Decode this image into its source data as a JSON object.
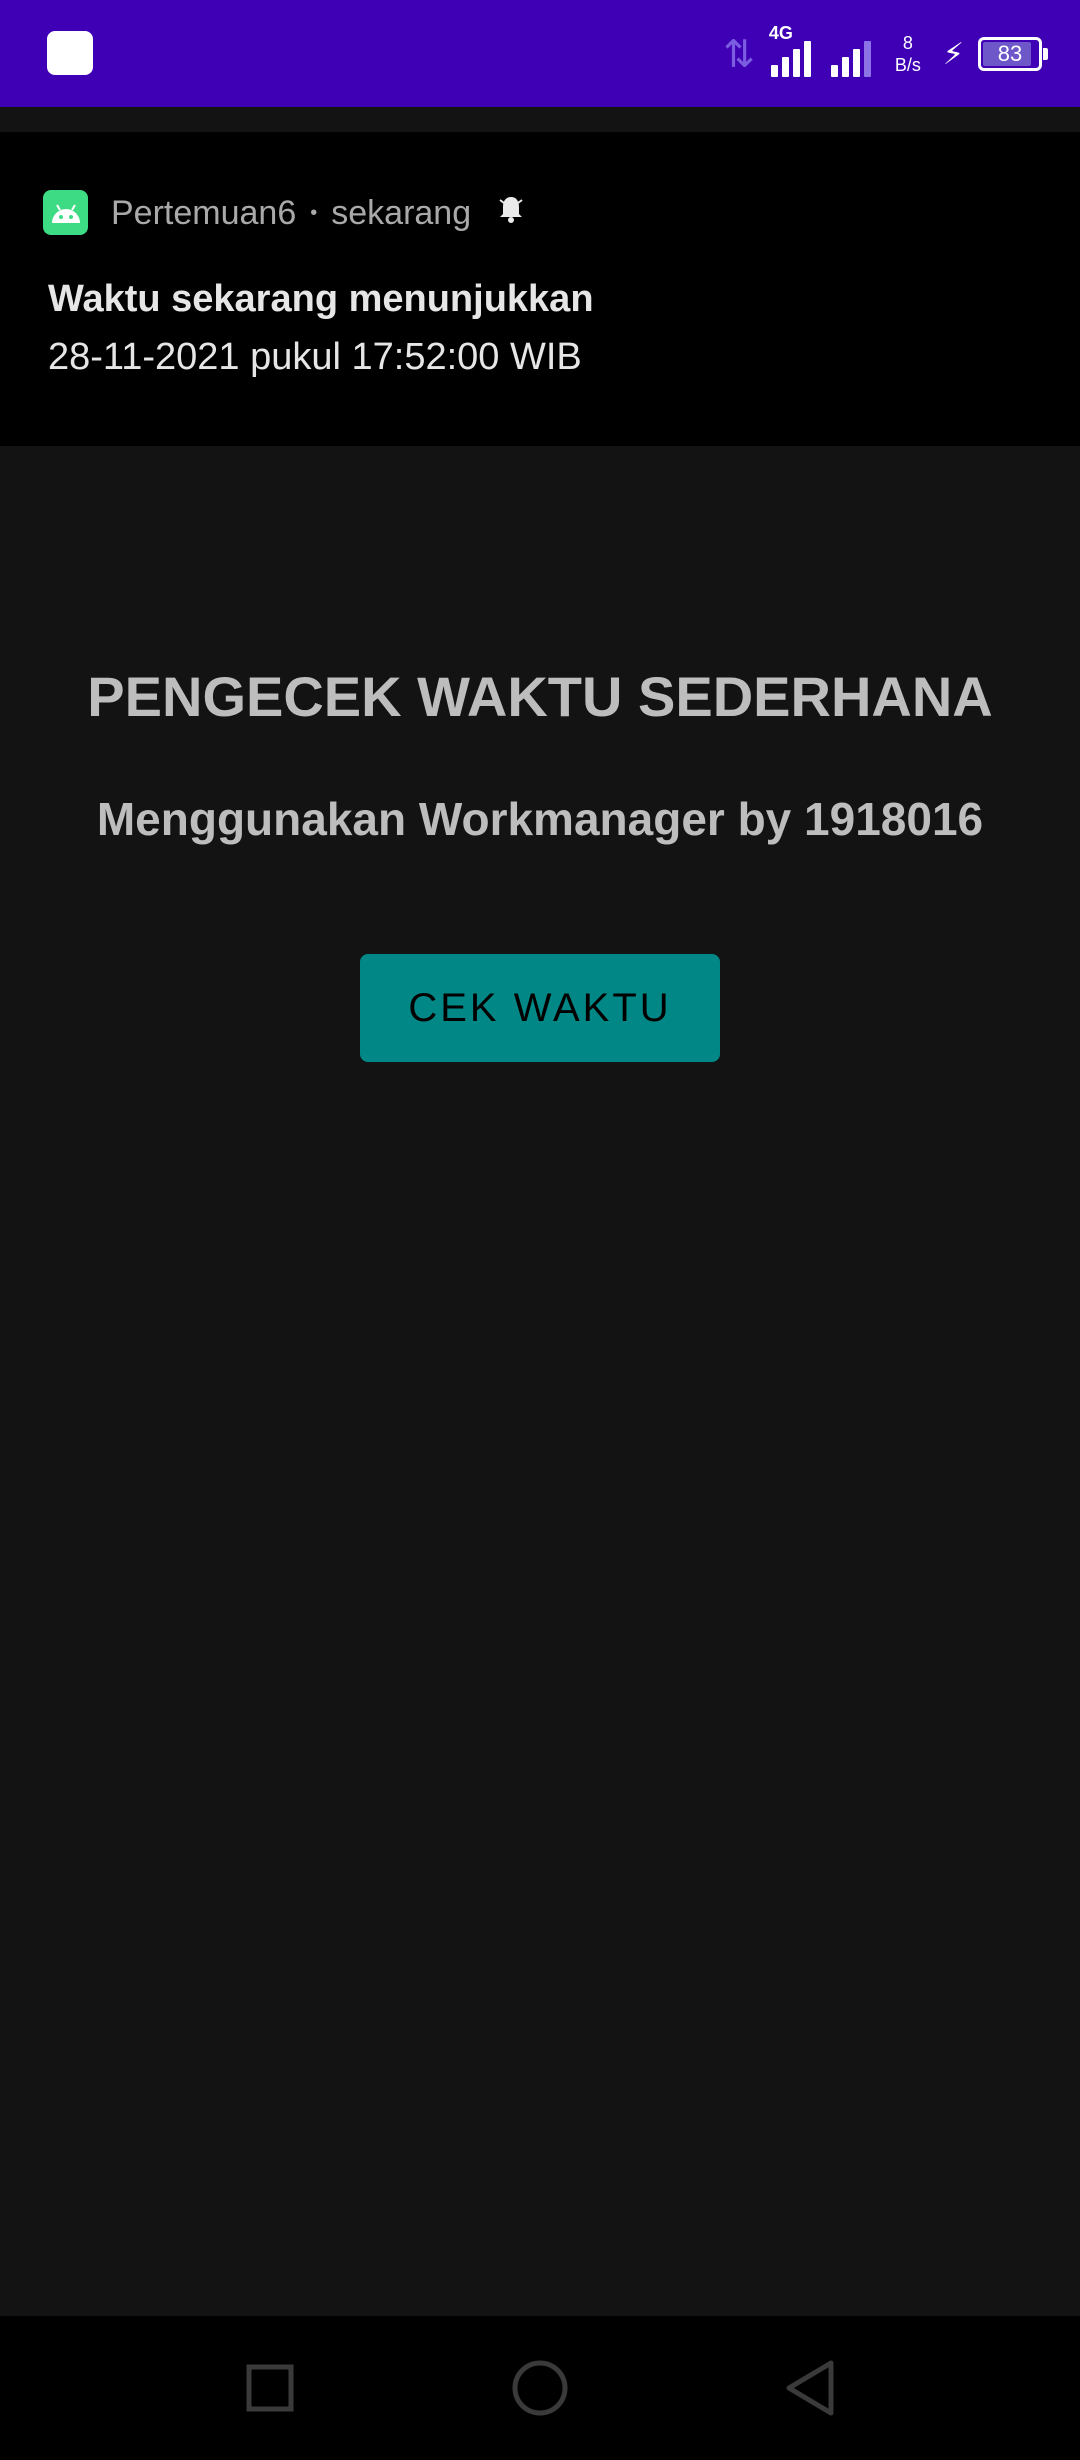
{
  "status_bar": {
    "network_type": "4G",
    "speed_value": "8",
    "speed_unit": "B/s",
    "battery_level": "83",
    "colors": {
      "background": "#3f00b5"
    }
  },
  "notification": {
    "app_name": "Pertemuan6",
    "separator": "•",
    "time": "sekarang",
    "title": "Waktu sekarang menunjukkan",
    "text": "28-11-2021 pukul 17:52:00 WIB",
    "icons": {
      "app": "android-icon",
      "alert": "bell-icon"
    }
  },
  "main": {
    "title": "PENGECEK WAKTU SEDERHANA",
    "subtitle": "Menggunakan Workmanager by 1918016",
    "button_label": "CEK WAKTU",
    "colors": {
      "button": "#018786",
      "background": "#131313",
      "text": "#bdbdbd"
    }
  },
  "nav_bar": {
    "icons": [
      "recents-square-icon",
      "home-circle-icon",
      "back-triangle-icon"
    ]
  }
}
